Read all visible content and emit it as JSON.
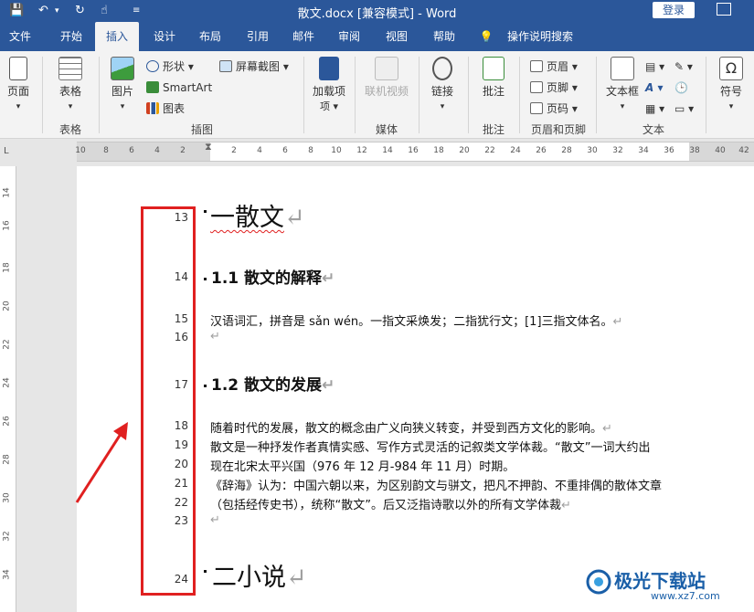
{
  "window": {
    "title": "散文.docx [兼容模式] - Word",
    "login_label": "登录"
  },
  "quick_access": {
    "save_icon": "save-icon",
    "undo_icon": "undo-icon",
    "redo_icon": "redo-icon",
    "touch_icon": "touch-mode-icon",
    "customize_icon": "customize-icon"
  },
  "tabs": [
    "文件",
    "开始",
    "插入",
    "设计",
    "布局",
    "引用",
    "邮件",
    "审阅",
    "视图",
    "帮助",
    "操作说明搜索"
  ],
  "active_tab": "插入",
  "ribbon": {
    "pages": "页面",
    "table": "表格",
    "picture": "图片",
    "shapes": "形状",
    "smartart": "SmartArt",
    "chart": "图表",
    "screenshot": "屏幕截图",
    "addins": "加载项",
    "online_video": "联机视频",
    "link": "链接",
    "comment": "批注",
    "header": "页眉",
    "footer": "页脚",
    "page_number": "页码",
    "textbox": "文本框",
    "symbol": "符号",
    "groups": {
      "tables": "表格",
      "illustrations": "插图",
      "media": "媒体",
      "comments": "批注",
      "header_footer": "页眉和页脚",
      "text": "文本"
    }
  },
  "ruler": {
    "left_ticks": [
      "10",
      "8",
      "6",
      "4",
      "2"
    ],
    "right_ticks": [
      "2",
      "4",
      "6",
      "8",
      "10",
      "12",
      "14",
      "16",
      "18",
      "20",
      "22",
      "24",
      "26",
      "28",
      "30",
      "32",
      "34",
      "36",
      "38",
      "40",
      "42"
    ],
    "vertical_ticks": [
      "14",
      "16",
      "18",
      "20",
      "22",
      "24",
      "26",
      "28",
      "30",
      "32",
      "34"
    ]
  },
  "document": {
    "line_numbers": [
      "13",
      "14",
      "15",
      "16",
      "17",
      "18",
      "19",
      "20",
      "21",
      "22",
      "23",
      "24"
    ],
    "h1_a": "一散文",
    "h2_a": "1.1 散文的解释",
    "p15": "汉语词汇，拼音是 sǎn wén。一指文采焕发；二指犹行文；[1]三指文体名。",
    "h2_b": "1.2 散文的发展",
    "p18": "随着时代的发展，散文的概念由广义向狭义转变，并受到西方文化的影响。",
    "p19": "散文是一种抒发作者真情实感、写作方式灵活的记叙类文学体裁。“散文”一词大约出",
    "p20": "现在北宋太平兴国（976 年 12 月-984 年 11 月）时期。",
    "p21": "《辞海》认为：中国六朝以来，为区别韵文与骈文，把凡不押韵、不重排偶的散体文章",
    "p22": "（包括经传史书），统称“散文”。后又泛指诗歌以外的所有文学体裁",
    "h1_b": "二小说",
    "para_mark": "↵"
  },
  "watermark": {
    "name": "极光下载站",
    "url": "www.xz7.com"
  },
  "colors": {
    "accent": "#2b579a",
    "highlight_box": "#e02020",
    "arrow": "#e02020"
  }
}
